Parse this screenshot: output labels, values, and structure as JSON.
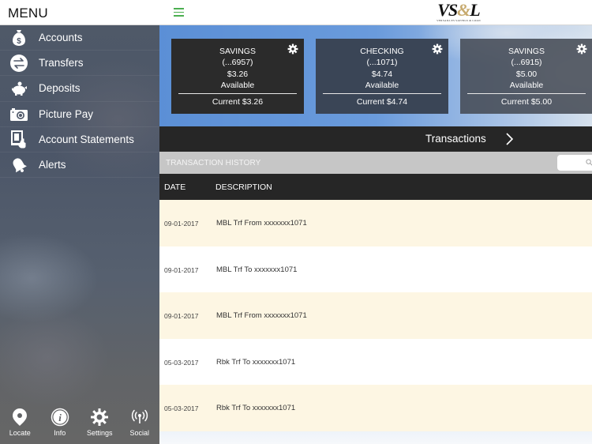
{
  "header": {
    "menu_title": "MENU",
    "logo_text": "VS",
    "logo_amp": "&",
    "logo_end": "L",
    "logo_subtitle": "VERSAILLES SAVINGS & LOAN",
    "accent_color": "#4caf50"
  },
  "sidebar": {
    "items": [
      {
        "label": "Accounts",
        "icon": "money-bag-icon"
      },
      {
        "label": "Transfers",
        "icon": "transfer-arrows-icon"
      },
      {
        "label": "Deposits",
        "icon": "piggy-bank-icon"
      },
      {
        "label": "Picture Pay",
        "icon": "camera-icon"
      },
      {
        "label": "Account Statements",
        "icon": "statement-tablet-icon"
      },
      {
        "label": "Alerts",
        "icon": "bell-icon"
      }
    ],
    "footer": [
      {
        "label": "Locate",
        "icon": "location-pin-icon"
      },
      {
        "label": "Info",
        "icon": "info-icon"
      },
      {
        "label": "Settings",
        "icon": "gear-icon"
      },
      {
        "label": "Social",
        "icon": "broadcast-icon"
      }
    ]
  },
  "accounts": [
    {
      "type": "SAVINGS",
      "number": "(...6957)",
      "available": "$3.26",
      "available_label": "Available",
      "current": "Current $3.26"
    },
    {
      "type": "CHECKING",
      "number": "(...1071)",
      "available": "$4.74",
      "available_label": "Available",
      "current": "Current $4.74"
    },
    {
      "type": "SAVINGS",
      "number": "(...6915)",
      "available": "$5.00",
      "available_label": "Available",
      "current": "Current $5.00"
    }
  ],
  "transactions_bar": {
    "title": "Transactions"
  },
  "history": {
    "title": "TRANSACTION HISTORY",
    "search_placeholder": "",
    "columns": [
      "DATE",
      "DESCRIPTION"
    ],
    "rows": [
      {
        "date": "09-01-2017",
        "description": "MBL Trf From xxxxxxx1071"
      },
      {
        "date": "09-01-2017",
        "description": "MBL Trf To xxxxxxx1071"
      },
      {
        "date": "09-01-2017",
        "description": "MBL Trf From xxxxxxx1071"
      },
      {
        "date": "05-03-2017",
        "description": "Rbk Trf To xxxxxxx1071"
      },
      {
        "date": "05-03-2017",
        "description": "Rbk Trf To xxxxxxx1071"
      }
    ]
  }
}
